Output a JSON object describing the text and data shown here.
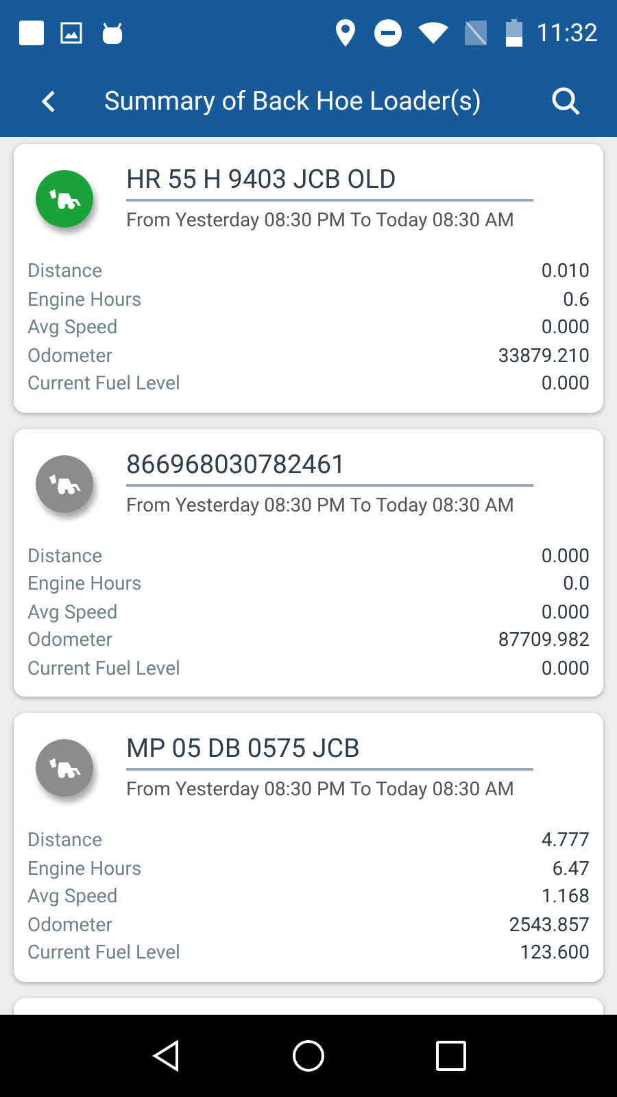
{
  "status_bar": {
    "time": "11:32"
  },
  "app_bar": {
    "title": "Summary of Back Hoe Loader(s)"
  },
  "vehicles": [
    {
      "name": "HR 55 H 9403 JCB OLD",
      "color": "#1aa33a",
      "period": "From Yesterday 08:30 PM To Today 08:30 AM",
      "stats": [
        {
          "label": "Distance",
          "value": "0.010"
        },
        {
          "label": "Engine Hours",
          "value": "0.6"
        },
        {
          "label": "Avg Speed",
          "value": "0.000"
        },
        {
          "label": "Odometer",
          "value": "33879.210"
        },
        {
          "label": "Current Fuel Level",
          "value": "0.000"
        }
      ]
    },
    {
      "name": "866968030782461",
      "color": "#8c8c8c",
      "period": "From Yesterday 08:30 PM To Today 08:30 AM",
      "stats": [
        {
          "label": "Distance",
          "value": "0.000"
        },
        {
          "label": "Engine Hours",
          "value": "0.0"
        },
        {
          "label": "Avg Speed",
          "value": "0.000"
        },
        {
          "label": "Odometer",
          "value": "87709.982"
        },
        {
          "label": "Current Fuel Level",
          "value": "0.000"
        }
      ]
    },
    {
      "name": "MP 05 DB 0575 JCB",
      "color": "#8c8c8c",
      "period": "From Yesterday 08:30 PM To Today 08:30 AM",
      "stats": [
        {
          "label": "Distance",
          "value": "4.777"
        },
        {
          "label": "Engine Hours",
          "value": "6.47"
        },
        {
          "label": "Avg Speed",
          "value": "1.168"
        },
        {
          "label": "Odometer",
          "value": "2543.857"
        },
        {
          "label": "Current Fuel Level",
          "value": "123.600"
        }
      ]
    }
  ]
}
